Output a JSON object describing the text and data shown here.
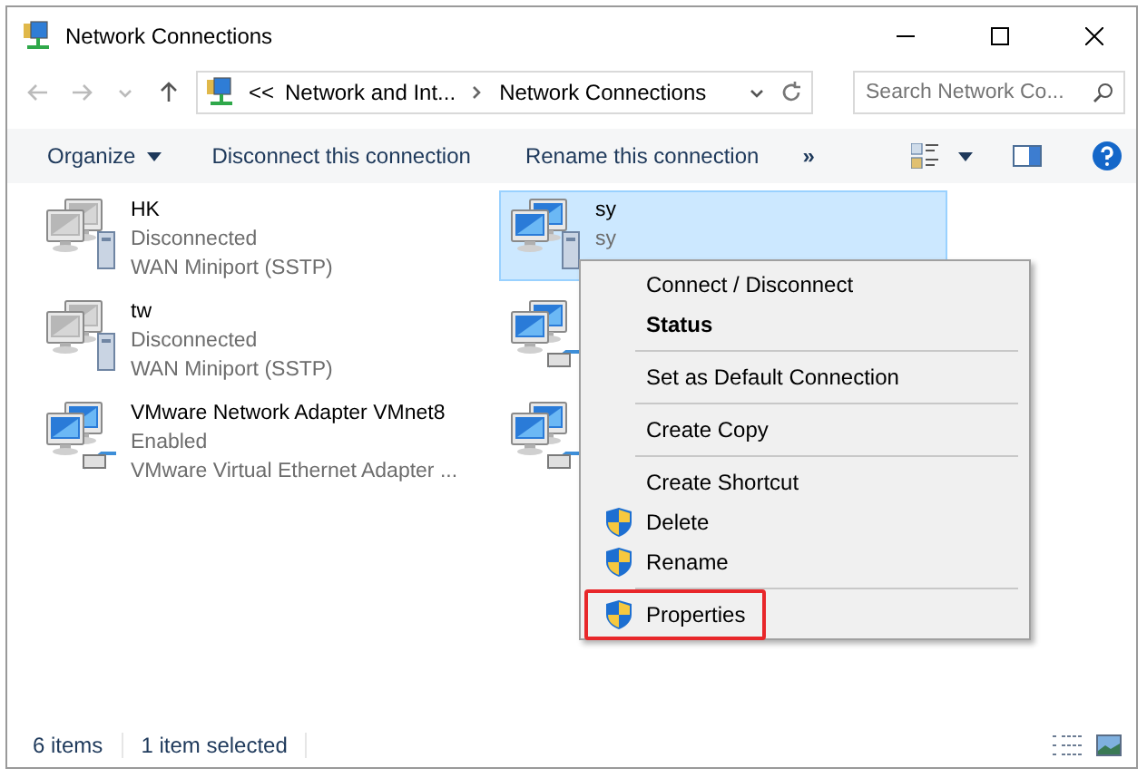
{
  "window": {
    "title": "Network Connections"
  },
  "address_bar": {
    "overflow": "<<",
    "crumbs": [
      "Network and Int...",
      "Network Connections"
    ]
  },
  "search": {
    "placeholder": "Search Network Co..."
  },
  "toolbar": {
    "organize": "Organize",
    "commands": [
      "Disconnect this connection",
      "Rename this connection"
    ],
    "more": "»"
  },
  "items": [
    {
      "name": "HK",
      "status": "Disconnected",
      "device": "WAN Miniport (SSTP)",
      "kind": "wan",
      "active": false,
      "selected": false
    },
    {
      "name": "sy",
      "status": "sy",
      "kind": "wan",
      "active": true,
      "selected": true
    },
    {
      "name": "tw",
      "status": "Disconnected",
      "device": "WAN Miniport (SSTP)",
      "kind": "wan",
      "active": false,
      "selected": false
    },
    {
      "kind": "ethernet",
      "active": true,
      "selected": false
    },
    {
      "name": "VMware Network Adapter VMnet8",
      "status": "Enabled",
      "device": "VMware Virtual Ethernet Adapter ...",
      "kind": "ethernet",
      "active": true,
      "selected": false
    },
    {
      "kind": "ethernet",
      "active": true,
      "selected": false
    }
  ],
  "context_menu": [
    {
      "kind": "item",
      "label": "Connect / Disconnect",
      "bold": false,
      "shield": false,
      "outlined": false
    },
    {
      "kind": "item",
      "label": "Status",
      "bold": true,
      "shield": false,
      "outlined": false
    },
    {
      "kind": "separator"
    },
    {
      "kind": "item",
      "label": "Set as Default Connection",
      "bold": false,
      "shield": false,
      "outlined": false
    },
    {
      "kind": "separator"
    },
    {
      "kind": "item",
      "label": "Create Copy",
      "bold": false,
      "shield": false,
      "outlined": false
    },
    {
      "kind": "separator"
    },
    {
      "kind": "item",
      "label": "Create Shortcut",
      "bold": false,
      "shield": false,
      "outlined": false
    },
    {
      "kind": "item",
      "label": "Delete",
      "bold": false,
      "shield": true,
      "outlined": false
    },
    {
      "kind": "item",
      "label": "Rename",
      "bold": false,
      "shield": true,
      "outlined": false
    },
    {
      "kind": "separator"
    },
    {
      "kind": "item",
      "label": "Properties",
      "bold": false,
      "shield": true,
      "outlined": true
    }
  ],
  "status_bar": {
    "count": "6 items",
    "selection": "1 item selected"
  }
}
